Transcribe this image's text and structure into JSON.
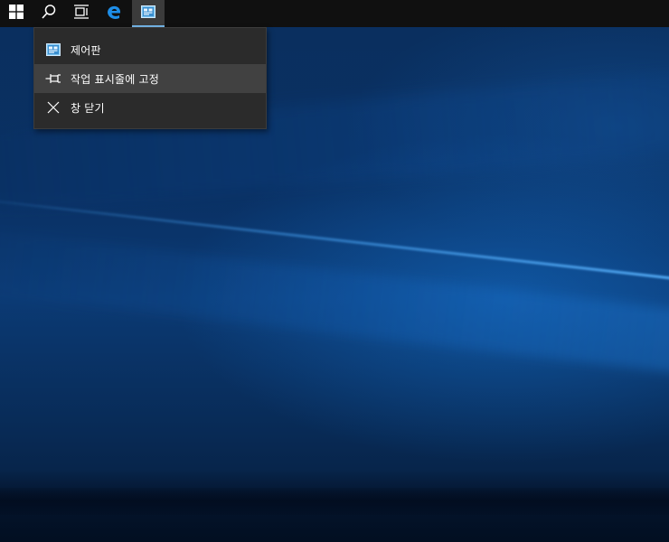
{
  "taskbar": {
    "buttons": [
      {
        "icon": "windows-start-icon"
      },
      {
        "icon": "search-icon"
      },
      {
        "icon": "task-view-icon"
      },
      {
        "icon": "edge-browser-icon"
      },
      {
        "icon": "control-panel-icon",
        "active": true
      }
    ],
    "accent_color": "#76b9ed"
  },
  "context_menu": {
    "items": [
      {
        "label": "제어판",
        "icon": "control-panel-icon"
      },
      {
        "label": "작업 표시줄에 고정",
        "icon": "pin-icon",
        "highlighted": true
      },
      {
        "label": "창 닫기",
        "icon": "close-icon"
      }
    ]
  },
  "colors": {
    "taskbar_bg": "#101010",
    "menu_bg": "#2b2b2b",
    "menu_hover": "#414141",
    "desktop_base": "#0a2f5e"
  }
}
